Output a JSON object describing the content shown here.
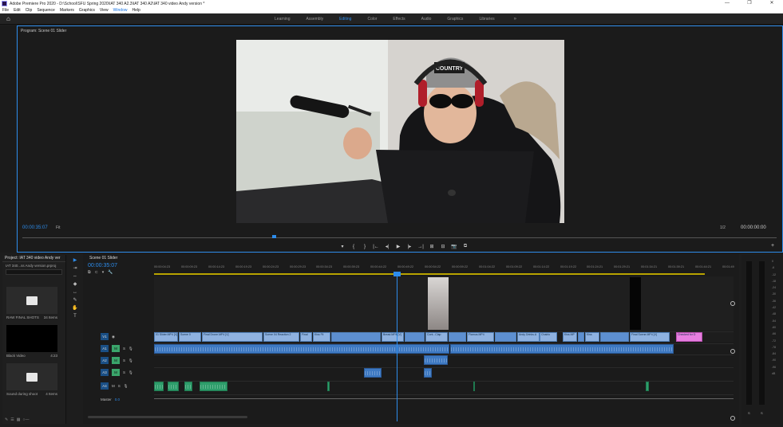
{
  "app": {
    "title": "Adobe Premiere Pro 2020 - D:\\School\\SFU Spring 2020\\IAT 340 A2.3\\IAT 340 A2\\IAT 340 video Andy version *",
    "window_controls": [
      "—",
      "❐",
      "✕"
    ]
  },
  "menu": [
    "File",
    "Edit",
    "Clip",
    "Sequence",
    "Markers",
    "Graphics",
    "View",
    "Window",
    "Help"
  ],
  "menu_active": "Window",
  "workspaces": {
    "items": [
      "Learning",
      "Assembly",
      "Editing",
      "Color",
      "Effects",
      "Audio",
      "Graphics",
      "Libraries"
    ],
    "active": "Editing",
    "more": "»"
  },
  "program_monitor": {
    "title": "Program: Scene 01 Slider",
    "timecode": "00:00:35:07",
    "fit": "Fit",
    "quality": "1/2",
    "duration": "00:00:00:00",
    "playhead_fraction": 0.33,
    "transport": [
      "▾",
      "{",
      "}",
      "|←",
      "◂|",
      "▶",
      "|▸",
      "→|",
      "⊞",
      "⊟",
      "📷",
      "⧉"
    ]
  },
  "project": {
    "tab": "Project: IAT 340 video Andy ver",
    "file": "IAT 340...ss Andy version.prproj",
    "bins": [
      {
        "name": "RAW FINAL SHOTS",
        "count": "34 Items",
        "kind": "folder"
      },
      {
        "name": "Black Video",
        "count": "4:23",
        "kind": "black"
      },
      {
        "name": "Sound during shoot",
        "count": "4 Items",
        "kind": "folder"
      }
    ]
  },
  "tools": [
    "▶",
    "⇥",
    "⇔",
    "◆",
    "↔",
    "✎",
    "✋",
    "T"
  ],
  "timeline": {
    "tab": "Scene 01 Slider",
    "timecode": "00:00:35:07",
    "ruler": [
      "00:00:04:23",
      "00:00:09:23",
      "00:00:14:23",
      "00:00:19:23",
      "00:00:24:23",
      "00:00:29:23",
      "00:00:34:23",
      "00:00:39:23",
      "00:00:44:22",
      "00:00:49:22",
      "00:00:54:22",
      "00:00:59:22",
      "00:01:04:22",
      "00:01:09:22",
      "00:01:14:22",
      "00:01:19:22",
      "00:01:24:21",
      "00:01:29:21",
      "00:01:34:21",
      "00:01:39:21",
      "00:01:44:21",
      "00:01:49"
    ],
    "tracks": {
      "video": [
        "V1"
      ],
      "audio": [
        "A1",
        "A2",
        "A3",
        "A4"
      ],
      "master": "Master",
      "master_value": "0.0"
    },
    "v1_clips": [
      "01 Slider.MP4 [V]",
      "Scene 0",
      "Final Drone.MP4 [V]",
      "Scene 04 Reaction 2",
      "Final",
      "Kiss Fli",
      "Bread.MP4 [V]",
      "Cont...Clap",
      "Flamus.MP4",
      "Andy Drinks.A",
      "Chairlo",
      "Kiss.MP",
      "Kiss",
      "Final Scene.MP4 [V]",
      "Checked for D"
    ]
  },
  "meters": {
    "scale": [
      "0",
      "-6",
      "-12",
      "-18",
      "-24",
      "-30",
      "-36",
      "-42",
      "-48",
      "-54",
      "-60",
      "-66",
      "-72",
      "-78",
      "-84",
      "-90",
      "-96",
      "dB"
    ],
    "labels": [
      "S",
      "S"
    ]
  },
  "colors": {
    "accent": "#2d8ceb",
    "video_clip": "#8fb2e0",
    "audio_clip": "#3e79c2",
    "audio_green": "#2e9d6b",
    "pink_clip": "#e77fe0"
  }
}
